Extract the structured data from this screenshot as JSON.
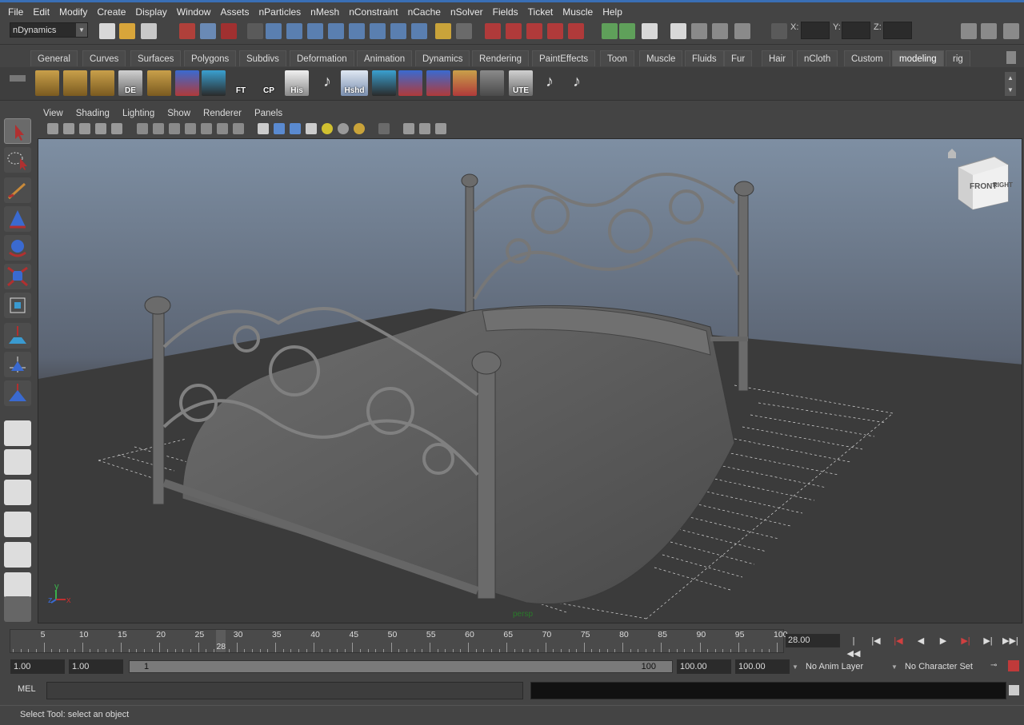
{
  "menubar": {
    "items": [
      "File",
      "Edit",
      "Modify",
      "Create",
      "Display",
      "Window",
      "Assets",
      "nParticles",
      "nMesh",
      "nConstraint",
      "nCache",
      "nSolver",
      "Fields",
      "Ticket",
      "Muscle",
      "Help"
    ]
  },
  "statusline": {
    "menuset": "nDynamics",
    "x_label": "X:",
    "y_label": "Y:",
    "z_label": "Z:"
  },
  "shelf": {
    "tabs": [
      "General",
      "Curves",
      "Surfaces",
      "Polygons",
      "Subdivs",
      "Deformation",
      "Animation",
      "Dynamics",
      "Rendering",
      "PaintEffects",
      "Toon",
      "Muscle",
      "Fluids",
      "Fur",
      "Hair",
      "nCloth",
      "Custom",
      "modeling",
      "rig"
    ],
    "active_tab": "modeling",
    "icon_labels": [
      "DE",
      "FT",
      "CP",
      "His",
      "Hshd",
      "UTE"
    ]
  },
  "viewport": {
    "menus": [
      "View",
      "Shading",
      "Lighting",
      "Show",
      "Renderer",
      "Panels"
    ],
    "camera": "persp",
    "viewcube_front": "FRONT",
    "viewcube_right": "RIGHT",
    "axis_x": "x",
    "axis_y": "y",
    "axis_z": "z"
  },
  "timeline": {
    "ticks": [
      5,
      10,
      15,
      20,
      25,
      30,
      35,
      40,
      45,
      50,
      55,
      60,
      65,
      70,
      75,
      80,
      85,
      90,
      95,
      100
    ],
    "current_frame": "28",
    "current_frame_field": "28.00"
  },
  "range": {
    "start": "1.00",
    "playback_start": "1.00",
    "slider_min": "1",
    "slider_max": "100",
    "playback_end": "100.00",
    "end": "100.00",
    "anim_layer": "No Anim Layer",
    "character_set": "No Character Set"
  },
  "cmdline": {
    "label": "MEL"
  },
  "helpline": {
    "text": "Select Tool: select an object"
  },
  "colors": {
    "accent": "#3a6fb5",
    "panel": "#444444",
    "viewport_top": "#7e8fa3",
    "viewport_bottom": "#3a3a3a"
  }
}
